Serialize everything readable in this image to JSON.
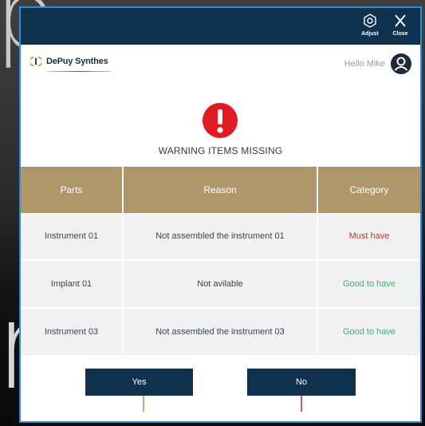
{
  "topbar": {
    "adjust_label": "Adjust",
    "close_label": "Close"
  },
  "brand": {
    "logo_text": "DePuy Synthes",
    "greeting": "Hello Mike"
  },
  "warning": {
    "title": "WARNING ITEMS MISSING"
  },
  "table": {
    "headers": [
      "Parts",
      "Reason",
      "Category"
    ],
    "rows": [
      {
        "part": "Instrument 01",
        "reason": "Not assembled the instrument 01",
        "category": "Must have",
        "status": "must"
      },
      {
        "part": "Implant 01",
        "reason": "Not avilable",
        "category": "Good to have",
        "status": "good"
      },
      {
        "part": "Instrument 03",
        "reason": "Not assembled the instrument 03",
        "category": "Good to have",
        "status": "good"
      }
    ]
  },
  "actions": {
    "yes_label": "Yes",
    "no_label": "No"
  },
  "colors": {
    "topbar": "#0f3150",
    "table_header": "#b0976b",
    "must_have": "#e02a2a",
    "good_to_have": "#3cb562",
    "warning_icon": "#e01b24",
    "dialog_border": "#2b8ed6"
  },
  "icons": [
    "adjust-icon",
    "close-icon",
    "logo-icon",
    "user-avatar-icon",
    "warning-icon"
  ]
}
